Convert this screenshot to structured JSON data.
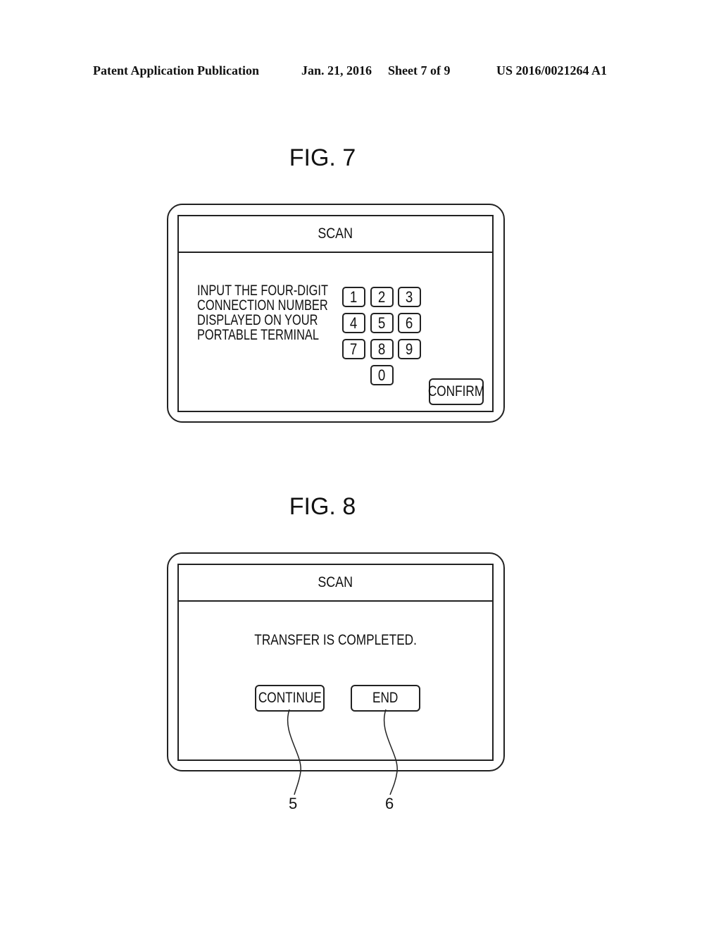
{
  "header": {
    "publication": "Patent Application Publication",
    "date": "Jan. 21, 2016",
    "sheet": "Sheet 7 of 9",
    "number": "US 2016/0021264 A1"
  },
  "fig7": {
    "title": "FIG. 7",
    "screen_title": "SCAN",
    "instruction_lines": [
      "INPUT THE FOUR-DIGIT",
      "CONNECTION NUMBER",
      "DISPLAYED ON YOUR",
      "PORTABLE TERMINAL"
    ],
    "keys": [
      "1",
      "2",
      "3",
      "4",
      "5",
      "6",
      "7",
      "8",
      "9",
      "0"
    ],
    "confirm_label": "CONFIRM"
  },
  "fig8": {
    "title": "FIG. 8",
    "screen_title": "SCAN",
    "message": "TRANSFER IS COMPLETED.",
    "continue_label": "CONTINUE",
    "end_label": "END",
    "ref_continue": "5",
    "ref_end": "6"
  }
}
